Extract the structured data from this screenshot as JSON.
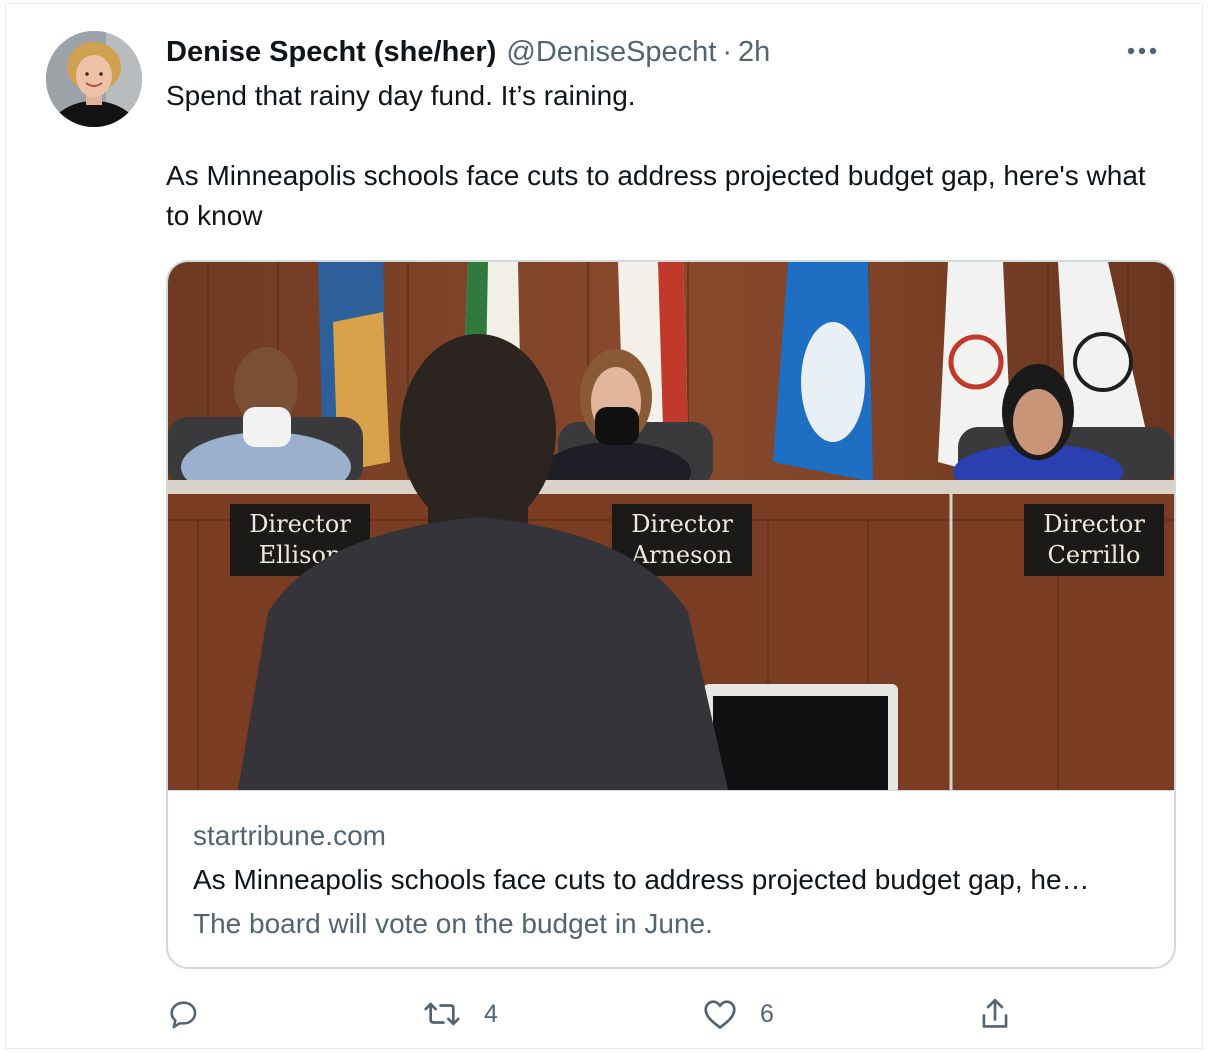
{
  "tweet": {
    "author_name": "Denise Specht (she/her)",
    "author_handle": "@DeniseSpecht",
    "separator": "·",
    "time": "2h",
    "text_line1": "Spend that rainy day fund. It’s raining.",
    "text_line2": "As Minneapolis schools face cuts to address projected budget gap, here's what to know"
  },
  "card": {
    "domain": "startribune.com",
    "title": "As Minneapolis schools face cuts to address projected budget gap, he…",
    "description": "The board will vote on the budget in June.",
    "image": {
      "nameplates": [
        {
          "line1": "Director",
          "line2": "Ellison"
        },
        {
          "line1": "Director",
          "line2": "Arneson"
        },
        {
          "line1": "Director",
          "line2": "Cerrillo"
        }
      ]
    }
  },
  "actions": {
    "reply_count": "",
    "retweet_count": "4",
    "like_count": "6"
  },
  "icons": {
    "more": "more-horizontal-icon",
    "reply": "reply-icon",
    "retweet": "retweet-icon",
    "like": "heart-icon",
    "share": "share-icon"
  },
  "colors": {
    "text_primary": "#0f1419",
    "text_secondary": "#536471",
    "border": "#cfd9de"
  }
}
